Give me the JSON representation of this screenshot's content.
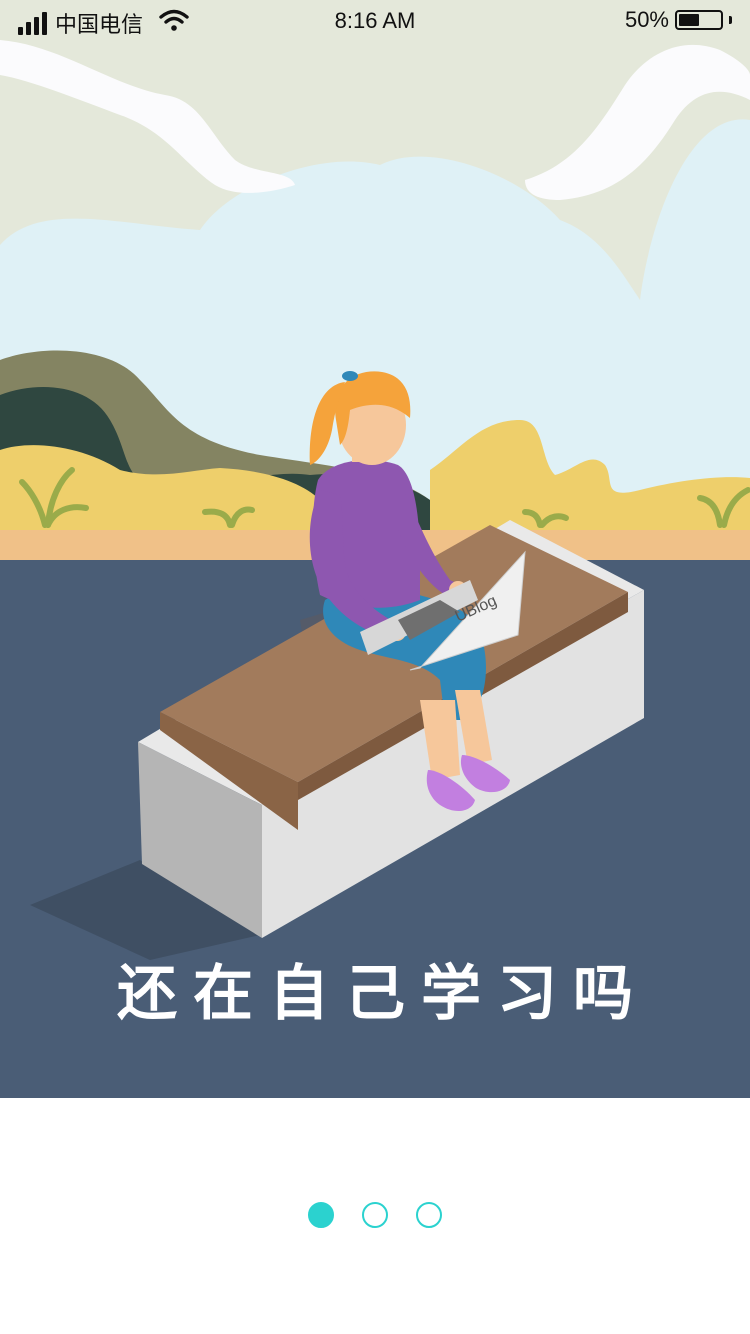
{
  "status_bar": {
    "carrier": "中国电信",
    "time": "8:16 AM",
    "battery": "50%",
    "battery_level": 0.5,
    "icons": [
      "signal-icon",
      "wifi-icon",
      "battery-icon"
    ]
  },
  "illustration": {
    "laptop_brand": "UBlog",
    "icon": "woman-on-bench-with-laptop-illustration"
  },
  "tagline": "还在自己学习吗",
  "pager": {
    "total": 3,
    "active_index": 0,
    "color": "#2bd2cf"
  },
  "colors": {
    "sky_cream": "#e4e8da",
    "sky_blue": "#dff1f6",
    "ground": "#4a5d76",
    "sand": "#f0c188",
    "accent": "#2bd2cf"
  }
}
